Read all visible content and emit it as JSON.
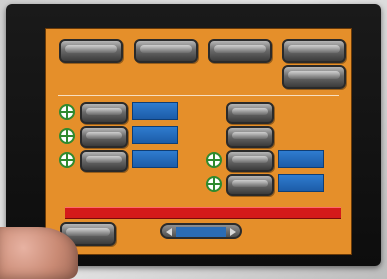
{
  "colors": {
    "screen_bg": "#e58f2a",
    "status_bar": "#d41a1a",
    "value_field": "#1c5ca8",
    "button_metal": "#6b6b6b",
    "icon_green": "#2f8a2f"
  },
  "top_buttons": [
    {
      "label": ""
    },
    {
      "label": ""
    },
    {
      "label": ""
    },
    {
      "label": ""
    },
    {
      "label": ""
    }
  ],
  "left_rows": [
    {
      "icon": "plus-target-icon",
      "button_label": "",
      "value": ""
    },
    {
      "icon": "plus-target-icon",
      "button_label": "",
      "value": ""
    },
    {
      "icon": "plus-target-icon",
      "button_label": "",
      "value": ""
    }
  ],
  "right_rows": [
    {
      "button_label": ""
    },
    {
      "button_label": ""
    },
    {
      "icon": "plus-target-icon",
      "button_label": "",
      "value": ""
    },
    {
      "icon": "plus-target-icon",
      "button_label": "",
      "value": ""
    }
  ],
  "status": {
    "message": ""
  },
  "bottom": {
    "left_button_label": "",
    "pager_text": ""
  }
}
